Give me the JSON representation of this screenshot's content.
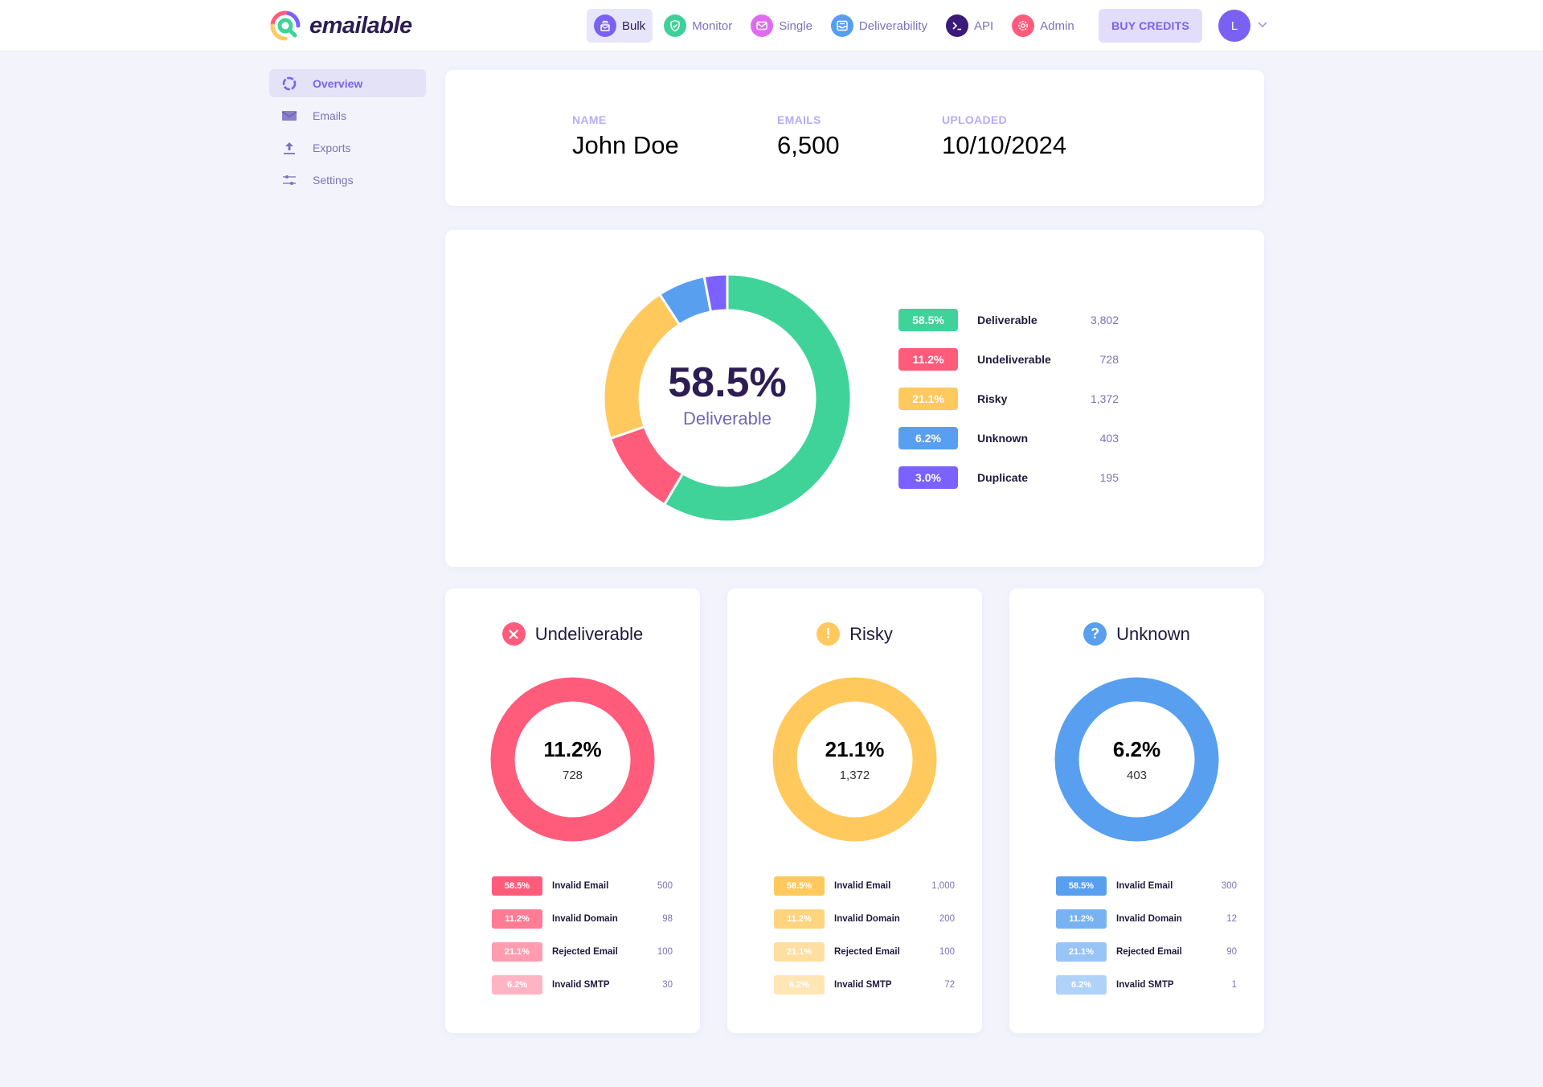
{
  "header": {
    "brand": "emailable",
    "nav": [
      {
        "label": "Bulk",
        "icon": "bulk-icon",
        "color": "#7b61f2",
        "active": true
      },
      {
        "label": "Monitor",
        "icon": "shield-check-icon",
        "color": "#3fd09a",
        "active": false
      },
      {
        "label": "Single",
        "icon": "envelope-icon",
        "color": "#df6cf0",
        "active": false
      },
      {
        "label": "Deliverability",
        "icon": "inbox-icon",
        "color": "#569ff0",
        "active": false
      },
      {
        "label": "API",
        "icon": "terminal-icon",
        "color": "#3b1b7a",
        "active": false
      },
      {
        "label": "Admin",
        "icon": "gear-icon",
        "color": "#ff5c7c",
        "active": false
      }
    ],
    "buy_credits": "BUY CREDITS",
    "avatar_initial": "L"
  },
  "sidebar": {
    "items": [
      {
        "label": "Overview",
        "icon": "donut-icon",
        "active": true
      },
      {
        "label": "Emails",
        "icon": "envelope-icon",
        "active": false
      },
      {
        "label": "Exports",
        "icon": "upload-icon",
        "active": false
      },
      {
        "label": "Settings",
        "icon": "sliders-icon",
        "active": false
      }
    ]
  },
  "info": {
    "name_label": "NAME",
    "name_value": "John Doe",
    "emails_label": "EMAILS",
    "emails_value": "6,500",
    "uploaded_label": "UPLOADED",
    "uploaded_value": "10/10/2024"
  },
  "colors": {
    "deliverable": "#3fd39a",
    "undeliverable": "#ff5c7c",
    "risky": "#ffc95e",
    "unknown": "#589ff0",
    "duplicate": "#7b61ff"
  },
  "chart_data": [
    {
      "type": "pie",
      "title": "58.5%",
      "subtitle": "Deliverable",
      "categories": [
        "Deliverable",
        "Undeliverable",
        "Risky",
        "Unknown",
        "Duplicate"
      ],
      "percent_labels": [
        "58.5%",
        "11.2%",
        "21.1%",
        "6.2%",
        "3.0%"
      ],
      "values": [
        3802,
        728,
        1372,
        403,
        195
      ],
      "count_labels": [
        "3,802",
        "728",
        "1,372",
        "403",
        "195"
      ],
      "legend": "right"
    },
    {
      "type": "pie",
      "title": "Undeliverable",
      "center_pct": "11.2%",
      "center_count": "728",
      "color": "#ff5c7c",
      "categories": [
        "Invalid Email",
        "Invalid Domain",
        "Rejected Email",
        "Invalid SMTP"
      ],
      "percent_labels": [
        "58.5%",
        "11.2%",
        "21.1%",
        "6.2%"
      ],
      "values": [
        500,
        98,
        100,
        30
      ],
      "count_labels": [
        "500",
        "98",
        "100",
        "30"
      ],
      "badge_colors": [
        "#ff5c7c",
        "#ff7c94",
        "#ff9caf",
        "#ffb4c3"
      ]
    },
    {
      "type": "pie",
      "title": "Risky",
      "center_pct": "21.1%",
      "center_count": "1,372",
      "color": "#ffc95e",
      "categories": [
        "Invalid Email",
        "Invalid Domain",
        "Rejected Email",
        "Invalid SMTP"
      ],
      "percent_labels": [
        "58.5%",
        "11.2%",
        "21.1%",
        "6.2%"
      ],
      "values": [
        1000,
        200,
        100,
        72
      ],
      "count_labels": [
        "1,000",
        "200",
        "100",
        "72"
      ],
      "badge_colors": [
        "#ffc95e",
        "#ffd47f",
        "#ffdf9f",
        "#ffe6b4"
      ]
    },
    {
      "type": "pie",
      "title": "Unknown",
      "center_pct": "6.2%",
      "center_count": "403",
      "color": "#589ff0",
      "categories": [
        "Invalid Email",
        "Invalid Domain",
        "Rejected Email",
        "Invalid SMTP"
      ],
      "percent_labels": [
        "58.5%",
        "11.2%",
        "21.1%",
        "6.2%"
      ],
      "values": [
        300,
        12,
        90,
        1
      ],
      "count_labels": [
        "300",
        "12",
        "90",
        "1"
      ],
      "badge_colors": [
        "#589ff0",
        "#78b2f3",
        "#98c4f6",
        "#b0d2f8"
      ]
    }
  ]
}
